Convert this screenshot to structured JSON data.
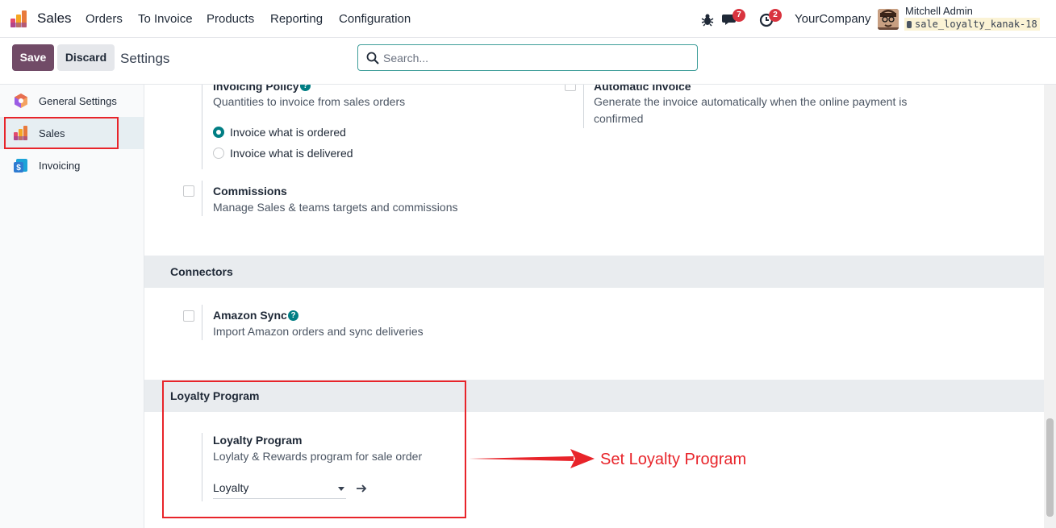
{
  "navbar": {
    "app_name": "Sales",
    "menu": [
      "Orders",
      "To Invoice",
      "Products",
      "Reporting",
      "Configuration"
    ],
    "messages_count": "7",
    "activities_count": "2",
    "company": "YourCompany",
    "user_name": "Mitchell Admin",
    "database": "sale_loyalty_kanak-18"
  },
  "control_panel": {
    "save_label": "Save",
    "discard_label": "Discard",
    "title": "Settings",
    "search_placeholder": "Search..."
  },
  "sidebar": {
    "items": [
      {
        "label": "General Settings",
        "icon": "general-settings-icon"
      },
      {
        "label": "Sales",
        "icon": "sales-app-icon",
        "active": true
      },
      {
        "label": "Invoicing",
        "icon": "invoicing-app-icon"
      }
    ]
  },
  "settings": {
    "invoicing_policy": {
      "title": "Invoicing Policy",
      "description": "Quantities to invoice from sales orders",
      "options": [
        "Invoice what is ordered",
        "Invoice what is delivered"
      ],
      "selected": "Invoice what is ordered"
    },
    "automatic_invoice": {
      "title": "Automatic Invoice",
      "description": "Generate the invoice automatically when the online payment is confirmed",
      "checked": false
    },
    "commissions": {
      "title": "Commissions",
      "description": "Manage Sales & teams targets and commissions",
      "checked": false
    },
    "connectors": {
      "heading": "Connectors",
      "amazon_sync": {
        "title": "Amazon Sync",
        "description": "Import Amazon orders and sync deliveries",
        "checked": false
      }
    },
    "loyalty": {
      "heading": "Loyalty Program",
      "title": "Loyalty Program",
      "description": "Loylaty & Rewards program for sale order",
      "selected_value": "Loyalty"
    }
  },
  "annotation": {
    "text": "Set Loyalty Program",
    "color": "#e8242a"
  },
  "colors": {
    "brand": "#714b67",
    "accent": "#017e84",
    "highlight": "#e8242a"
  }
}
